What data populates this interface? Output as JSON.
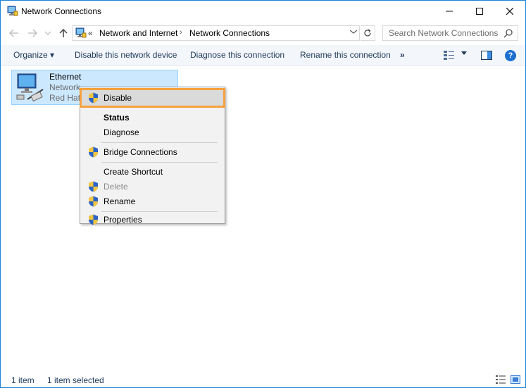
{
  "window": {
    "title": "Network Connections",
    "icon": "network-connections-icon"
  },
  "address_bar": {
    "chevron": "«",
    "breadcrumbs": [
      "Network and Internet",
      "Network Connections"
    ],
    "separator": "›"
  },
  "search": {
    "placeholder": "Search Network Connections"
  },
  "command_bar": {
    "organize": "Organize ▾",
    "disable": "Disable this network device",
    "diagnose": "Diagnose this connection",
    "rename": "Rename this connection",
    "more": "»",
    "help": "?"
  },
  "items": [
    {
      "name": "Ethernet",
      "status": "Network",
      "device": "Red Hat"
    }
  ],
  "context_menu": {
    "items": [
      {
        "label": "Disable",
        "icon": "shield-icon",
        "highlighted": true
      },
      {
        "label": "Status",
        "bold": true
      },
      {
        "label": "Diagnose"
      },
      {
        "label": "Bridge Connections",
        "icon": "shield-icon"
      },
      {
        "label": "Create Shortcut"
      },
      {
        "label": "Delete",
        "icon": "shield-icon",
        "disabled": true
      },
      {
        "label": "Rename",
        "icon": "shield-icon"
      },
      {
        "label": "Properties",
        "icon": "shield-icon"
      }
    ]
  },
  "status_bar": {
    "count": "1 item",
    "selected": "1 item selected"
  },
  "colors": {
    "accent": "#1883d7",
    "selection": "#cce8ff",
    "highlight_outline": "#f7a13e",
    "command_text": "#1e395b"
  }
}
